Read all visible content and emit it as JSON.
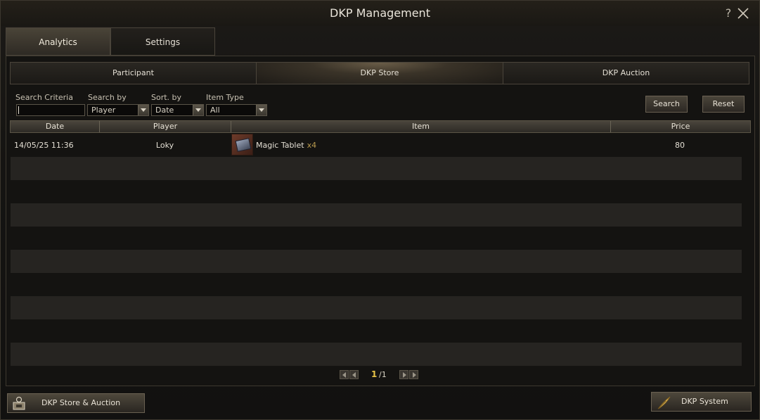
{
  "window": {
    "title": "DKP Management"
  },
  "tabs": [
    {
      "label": "Analytics",
      "active": true
    },
    {
      "label": "Settings",
      "active": false
    }
  ],
  "subtabs": [
    {
      "label": "Participant",
      "active": false
    },
    {
      "label": "DKP Store",
      "active": true
    },
    {
      "label": "DKP Auction",
      "active": false
    }
  ],
  "filters": {
    "search_criteria_label": "Search Criteria",
    "search_criteria_value": "",
    "search_by_label": "Search by",
    "search_by_value": "Player",
    "sort_by_label": "Sort. by",
    "sort_by_value": "Date",
    "item_type_label": "Item Type",
    "item_type_value": "All",
    "search_button": "Search",
    "reset_button": "Reset"
  },
  "table": {
    "columns": [
      "Date",
      "Player",
      "Item",
      "Price"
    ],
    "rows": [
      {
        "date": "14/05/25 11:36",
        "player": "Loky",
        "item": "Magic Tablet",
        "qty": "x4",
        "price": "80"
      }
    ]
  },
  "pager": {
    "current": "1",
    "total": "/1"
  },
  "footer": {
    "store_auction_label": "DKP Store & Auction",
    "dkp_system_label": "DKP System"
  },
  "colors": {
    "accent_gold": "#e8c447",
    "qty_color": "#b89a4e"
  }
}
